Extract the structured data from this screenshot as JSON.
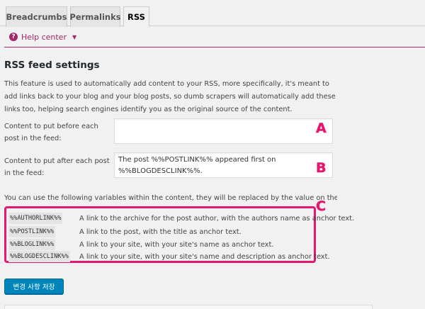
{
  "tabs": [
    {
      "label": "Breadcrumbs",
      "active": false
    },
    {
      "label": "Permalinks",
      "active": false
    },
    {
      "label": "RSS",
      "active": true
    }
  ],
  "help": {
    "icon": "?",
    "label": "Help center",
    "caret": "▼",
    "color": "#a4286a"
  },
  "section": {
    "title": "RSS feed settings",
    "intro": "This feature is used to automatically add content to your RSS, more specifically, it's meant to add links back to your blog and your blog posts, so dumb scrapers will automatically add these links too, helping search engines identify you as the original source of the content."
  },
  "fields": {
    "before": {
      "label": "Content to put before each post in the feed:",
      "value": ""
    },
    "after": {
      "label": "Content to put after each post in the feed:",
      "value": "The post %%POSTLINK%% appeared first on %%BLOGDESCLINK%%."
    }
  },
  "callouts": {
    "a": "A",
    "b": "B",
    "c": "C",
    "color": "#e6176f"
  },
  "variables": {
    "intro": "You can use the following variables within the content, they will be replaced by the value on the right.",
    "rows": [
      {
        "code": "%%AUTHORLINK%%",
        "desc": "A link to the archive for the post author, with the authors name as anchor text."
      },
      {
        "code": "%%POSTLINK%%",
        "desc": "A link to the post, with the title as anchor text."
      },
      {
        "code": "%%BLOGLINK%%",
        "desc": "A link to your site, with your site's name as anchor text."
      },
      {
        "code": "%%BLOGDESCLINK%%",
        "desc": "A link to your site, with your site's name and description as anchor text."
      }
    ]
  },
  "save_label": "변경 사항 저장",
  "colors": {
    "primary_button": "#0085ba",
    "accent": "#a4286a"
  }
}
